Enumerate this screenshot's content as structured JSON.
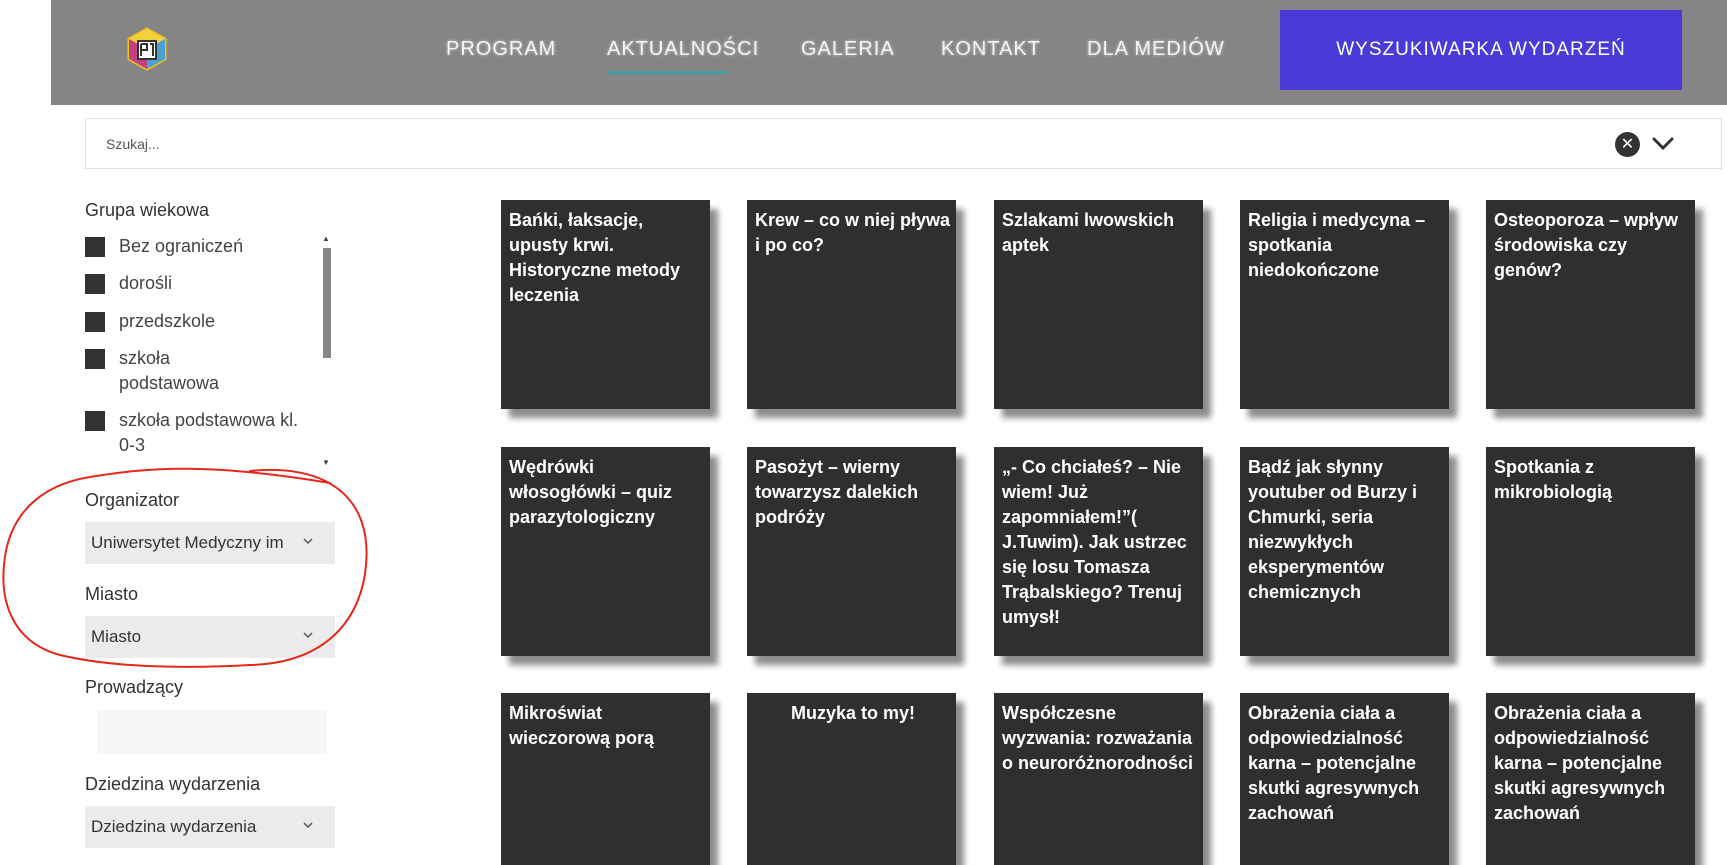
{
  "header": {
    "nav": [
      {
        "label": "PROGRAM"
      },
      {
        "label": "AKTUALNOŚCI"
      },
      {
        "label": "GALERIA"
      },
      {
        "label": "KONTAKT"
      },
      {
        "label": "DLA MEDIÓW"
      }
    ],
    "active_nav": "AKTUALNOŚCI",
    "search_events_button": "WYSZUKIWARKA WYDARZEŃ",
    "colors": {
      "header_bg": "#858585",
      "button_bg": "#4a3ad8",
      "active_underline": "#3aa0a0"
    }
  },
  "search": {
    "placeholder": "Szukaj...",
    "value": ""
  },
  "sidebar": {
    "age_group": {
      "label": "Grupa wiekowa",
      "options": [
        {
          "label": "Bez ograniczeń",
          "checked": false
        },
        {
          "label": "dorośli",
          "checked": false
        },
        {
          "label": "przedszkole",
          "checked": false
        },
        {
          "label": "szkoła podstawowa",
          "checked": false
        },
        {
          "label": "szkoła podstawowa kl. 0-3",
          "checked": false
        }
      ]
    },
    "organizer": {
      "label": "Organizator",
      "selected": "Uniwersytet Medyczny im"
    },
    "city": {
      "label": "Miasto",
      "selected": "Miasto"
    },
    "host": {
      "label": "Prowadzący",
      "value": ""
    },
    "domain": {
      "label": "Dziedzina wydarzenia",
      "selected": "Dziedzina wydarzenia"
    }
  },
  "events": [
    {
      "title": "Bańki, łaksacje, upusty krwi. Historyczne metody leczenia"
    },
    {
      "title": "Krew – co w niej pływa i po co?"
    },
    {
      "title": "Szlakami lwowskich aptek"
    },
    {
      "title": "Religia i medycyna – spotkania niedokończone"
    },
    {
      "title": "Osteoporoza – wpływ środowiska czy genów?"
    },
    {
      "title": "Wędrówki włosogłówki – quiz parazytologiczny"
    },
    {
      "title": "Pasożyt – wierny towarzysz dalekich podróży"
    },
    {
      "title": "„- Co chciałeś? – Nie wiem! Już zapomniałem!”( J.Tuwim). Jak ustrzec się losu Tomasza Trąbalskiego? Trenuj umysł!"
    },
    {
      "title": "Bądź jak słynny youtuber od Burzy i Chmurki, seria niezwykłych eksperymentów chemicznych"
    },
    {
      "title": "Spotkania z mikrobiologią"
    },
    {
      "title": "Mikroświat wieczorową porą"
    },
    {
      "title": "Muzyka to my!"
    },
    {
      "title": "Współczesne wyzwania: rozważania o neuroróżnorodności"
    },
    {
      "title": "Obrażenia ciała a odpowiedzialność karna – potencjalne skutki agresywnych zachowań"
    },
    {
      "title": "Obrażenia ciała a odpowiedzialność karna – potencjalne skutki agresywnych zachowań"
    }
  ]
}
